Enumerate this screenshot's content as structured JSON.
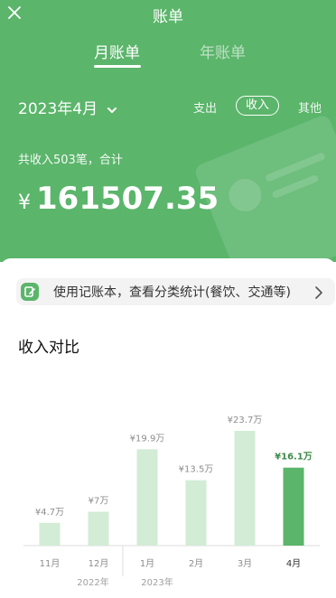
{
  "header": {
    "title": "账单",
    "tabs": [
      {
        "label": "月账单",
        "active": true
      },
      {
        "label": "年账单",
        "active": false
      }
    ],
    "period": "2023年4月",
    "filters": [
      {
        "label": "支出",
        "active": false
      },
      {
        "label": "收入",
        "active": true
      },
      {
        "label": "其他",
        "active": false
      }
    ],
    "summary": "共收入503笔，合计",
    "currency": "¥",
    "amount": "161507.35",
    "accent_color": "#5bb56b"
  },
  "banner": {
    "text": "使用记账本，查看分类统计(餐饮、交通等)",
    "icon": "ledger-icon"
  },
  "comparison": {
    "title": "收入对比"
  },
  "chart_data": {
    "type": "bar",
    "categories": [
      "11月",
      "12月",
      "1月",
      "2月",
      "3月",
      "4月"
    ],
    "values": [
      4.7,
      7,
      19.9,
      13.5,
      23.7,
      16.1
    ],
    "value_labels": [
      "¥4.7万",
      "¥7万",
      "¥19.9万",
      "¥13.5万",
      "¥23.7万",
      "¥16.1万"
    ],
    "year_labels": [
      "2022年",
      "2023年"
    ],
    "highlight_index": 5,
    "colors": {
      "normal": "#d2ecd6",
      "highlight": "#5bb56b",
      "label": "#8d8d8d",
      "highlight_label": "#3c8a4a"
    },
    "ylim": [
      0,
      25
    ]
  }
}
